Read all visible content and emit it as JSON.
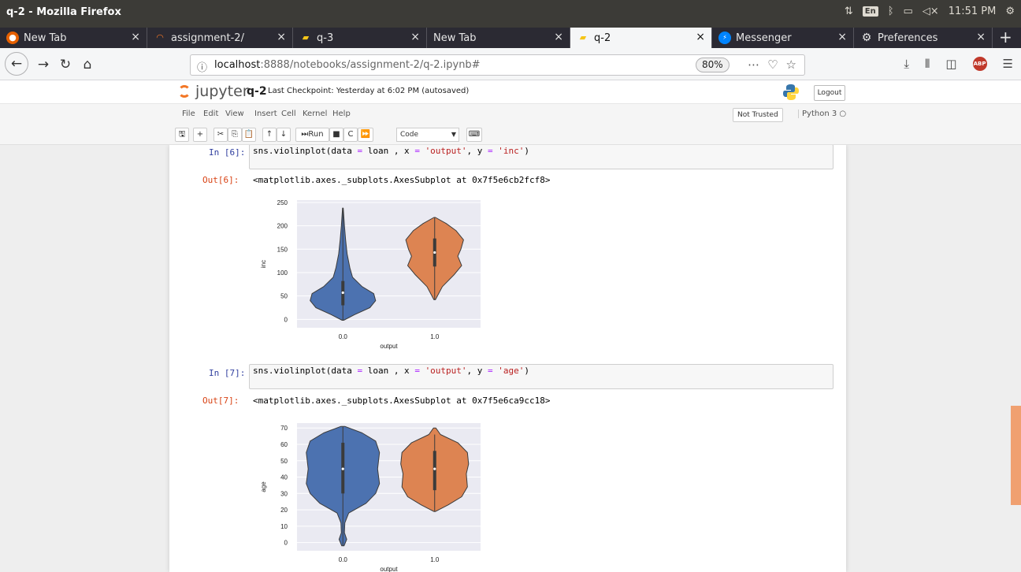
{
  "os": {
    "window_title": "q-2 - Mozilla Firefox",
    "keyboard": "En",
    "time": "11:51 PM"
  },
  "tabs": [
    {
      "label": "New Tab",
      "icon": "firefox-icon",
      "active": false
    },
    {
      "label": "assignment-2/",
      "icon": "jupyter-icon",
      "active": false
    },
    {
      "label": "q-3",
      "icon": "notebook-icon",
      "active": false
    },
    {
      "label": "New Tab",
      "icon": "none",
      "active": false
    },
    {
      "label": "q-2",
      "icon": "notebook-icon",
      "active": true
    },
    {
      "label": "Messenger",
      "icon": "messenger-icon",
      "active": false
    },
    {
      "label": "Preferences",
      "icon": "gear-icon",
      "active": false
    }
  ],
  "nav": {
    "url_host": "localhost",
    "url_rest": ":8888/notebooks/assignment-2/q-2.ipynb#",
    "zoom": "80%",
    "adblock": "ABP"
  },
  "jupyter": {
    "logo_text": "jupyter",
    "notebook_name": "q-2",
    "checkpoint": "Last Checkpoint: Yesterday at 6:02 PM  (autosaved)",
    "logout": "Logout",
    "menu": [
      "File",
      "Edit",
      "View",
      "Insert",
      "Cell",
      "Kernel",
      "Help"
    ],
    "trusted": "Not Trusted",
    "kernel": "Python 3",
    "run_label": "Run",
    "cell_type": "Code"
  },
  "cells": [
    {
      "in_prompt": "In [6]:",
      "code_pre": "sns.violinplot(data ",
      "code_mid1": " loan , x ",
      "code_str1": "'output'",
      "code_mid2": ", y ",
      "code_str2": "'inc'",
      "code_end": ")",
      "out_prompt": "Out[6]:",
      "out_text": "<matplotlib.axes._subplots.AxesSubplot at 0x7f5e6cb2fcf8>"
    },
    {
      "in_prompt": "In [7]:",
      "code_pre": "sns.violinplot(data ",
      "code_mid1": " loan , x ",
      "code_str1": "'output'",
      "code_mid2": ", y ",
      "code_str2": "'age'",
      "code_end": ")",
      "out_prompt": "Out[7]:",
      "out_text": "<matplotlib.axes._subplots.AxesSubplot at 0x7f5e6ca9cc18>"
    }
  ],
  "chart_data": [
    {
      "type": "violin",
      "categories": [
        "0.0",
        "1.0"
      ],
      "xlabel": "output",
      "ylabel": "inc",
      "yticks": [
        0,
        50,
        100,
        150,
        200,
        250
      ],
      "ylim": [
        -18,
        255
      ],
      "colors": [
        "#4c72b0",
        "#dd8452"
      ],
      "series": [
        {
          "category": "0.0",
          "min": -2,
          "q1": 30,
          "median": 57,
          "q3": 82,
          "max": 238,
          "density": [
            [
              -2,
              0.02
            ],
            [
              10,
              0.3
            ],
            [
              25,
              0.7
            ],
            [
              40,
              0.85
            ],
            [
              55,
              0.8
            ],
            [
              70,
              0.5
            ],
            [
              90,
              0.25
            ],
            [
              110,
              0.18
            ],
            [
              140,
              0.11
            ],
            [
              170,
              0.07
            ],
            [
              200,
              0.04
            ],
            [
              238,
              0.01
            ]
          ]
        },
        {
          "category": "1.0",
          "min": 42,
          "q1": 113,
          "median": 143,
          "q3": 173,
          "max": 218,
          "density": [
            [
              42,
              0.02
            ],
            [
              70,
              0.2
            ],
            [
              95,
              0.5
            ],
            [
              115,
              0.7
            ],
            [
              135,
              0.6
            ],
            [
              150,
              0.68
            ],
            [
              170,
              0.75
            ],
            [
              190,
              0.55
            ],
            [
              205,
              0.3
            ],
            [
              218,
              0.02
            ]
          ]
        }
      ]
    },
    {
      "type": "violin",
      "categories": [
        "0.0",
        "1.0"
      ],
      "xlabel": "output",
      "ylabel": "age",
      "yticks": [
        0,
        10,
        20,
        30,
        40,
        50,
        60,
        70
      ],
      "ylim": [
        -5,
        73
      ],
      "colors": [
        "#4c72b0",
        "#dd8452"
      ],
      "series": [
        {
          "category": "0.0",
          "min": -2,
          "q1": 30,
          "median": 45,
          "q3": 61,
          "max": 71,
          "density": [
            [
              -2,
              0.03
            ],
            [
              2,
              0.1
            ],
            [
              6,
              0.04
            ],
            [
              12,
              0.05
            ],
            [
              18,
              0.15
            ],
            [
              24,
              0.6
            ],
            [
              30,
              0.85
            ],
            [
              36,
              0.95
            ],
            [
              45,
              0.9
            ],
            [
              55,
              0.95
            ],
            [
              62,
              0.85
            ],
            [
              67,
              0.5
            ],
            [
              71,
              0.05
            ]
          ]
        },
        {
          "category": "1.0",
          "min": 19,
          "q1": 32,
          "median": 45,
          "q3": 56,
          "max": 66,
          "density": [
            [
              19,
              0.02
            ],
            [
              23,
              0.35
            ],
            [
              28,
              0.7
            ],
            [
              34,
              0.85
            ],
            [
              42,
              0.82
            ],
            [
              48,
              0.88
            ],
            [
              55,
              0.85
            ],
            [
              61,
              0.6
            ],
            [
              66,
              0.15
            ],
            [
              70,
              0.03
            ]
          ]
        }
      ]
    }
  ]
}
